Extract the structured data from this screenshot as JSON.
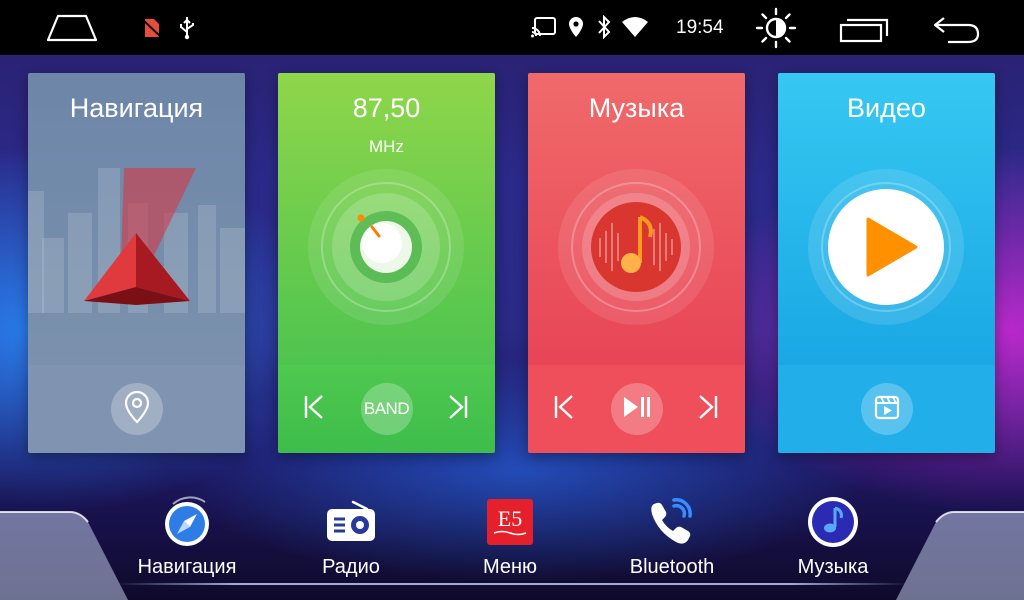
{
  "status_bar": {
    "time": "19:54",
    "icons": [
      "home-icon",
      "no-sim-icon",
      "usb-icon",
      "cast-icon",
      "location-icon",
      "bluetooth-icon",
      "wifi-icon",
      "brightness-icon",
      "recent-apps-icon",
      "back-icon"
    ]
  },
  "cards": {
    "navigation": {
      "title": "Навигация",
      "bottom_icon": "location-pin-icon",
      "color": "#7b91ad"
    },
    "radio": {
      "frequency": "87,50",
      "unit": "MHz",
      "prev_icon": "prev-icon",
      "band_label": "BAND",
      "next_icon": "next-icon",
      "color": "#4ec44f"
    },
    "music": {
      "title": "Музыка",
      "prev_icon": "prev-icon",
      "play_icon": "play-pause-icon",
      "next_icon": "next-icon",
      "color": "#e84556"
    },
    "video": {
      "title": "Видео",
      "bottom_icon": "video-list-icon",
      "color": "#1aa7e4"
    }
  },
  "dock": [
    {
      "label": "Навигация",
      "icon": "compass-icon"
    },
    {
      "label": "Радио",
      "icon": "radio-icon"
    },
    {
      "label": "Меню",
      "icon": "e5-menu-icon",
      "icon_text": "E5"
    },
    {
      "label": "Bluetooth",
      "icon": "phone-bluetooth-icon"
    },
    {
      "label": "Музыка",
      "icon": "music-note-icon"
    }
  ],
  "colors": {
    "status_bar_bg": "#000000",
    "accent_orange": "#ff8a00"
  }
}
